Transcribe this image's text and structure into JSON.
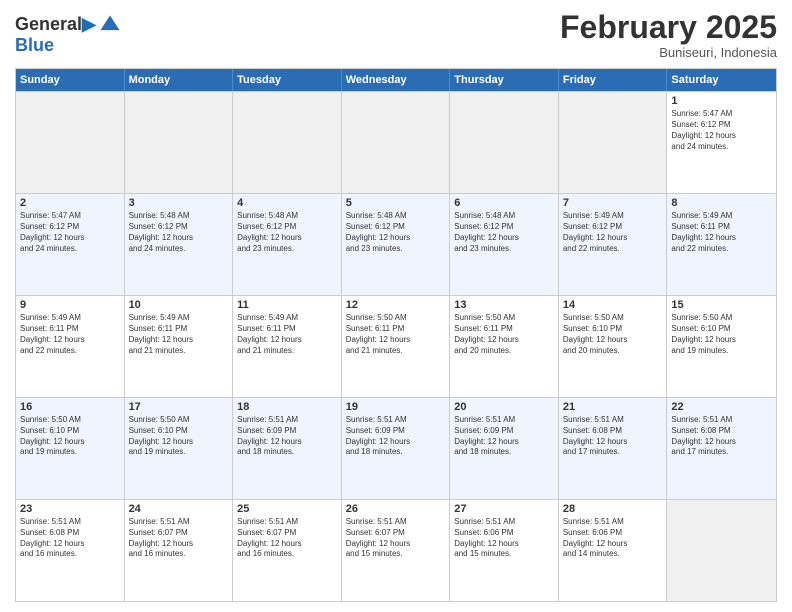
{
  "header": {
    "logo_line1": "General",
    "logo_line2": "Blue",
    "month": "February 2025",
    "location": "Buniseuri, Indonesia"
  },
  "days_of_week": [
    "Sunday",
    "Monday",
    "Tuesday",
    "Wednesday",
    "Thursday",
    "Friday",
    "Saturday"
  ],
  "weeks": [
    [
      {
        "day": "",
        "text": ""
      },
      {
        "day": "",
        "text": ""
      },
      {
        "day": "",
        "text": ""
      },
      {
        "day": "",
        "text": ""
      },
      {
        "day": "",
        "text": ""
      },
      {
        "day": "",
        "text": ""
      },
      {
        "day": "1",
        "text": "Sunrise: 5:47 AM\nSunset: 6:12 PM\nDaylight: 12 hours\nand 24 minutes."
      }
    ],
    [
      {
        "day": "2",
        "text": "Sunrise: 5:47 AM\nSunset: 6:12 PM\nDaylight: 12 hours\nand 24 minutes."
      },
      {
        "day": "3",
        "text": "Sunrise: 5:48 AM\nSunset: 6:12 PM\nDaylight: 12 hours\nand 24 minutes."
      },
      {
        "day": "4",
        "text": "Sunrise: 5:48 AM\nSunset: 6:12 PM\nDaylight: 12 hours\nand 23 minutes."
      },
      {
        "day": "5",
        "text": "Sunrise: 5:48 AM\nSunset: 6:12 PM\nDaylight: 12 hours\nand 23 minutes."
      },
      {
        "day": "6",
        "text": "Sunrise: 5:48 AM\nSunset: 6:12 PM\nDaylight: 12 hours\nand 23 minutes."
      },
      {
        "day": "7",
        "text": "Sunrise: 5:49 AM\nSunset: 6:12 PM\nDaylight: 12 hours\nand 22 minutes."
      },
      {
        "day": "8",
        "text": "Sunrise: 5:49 AM\nSunset: 6:11 PM\nDaylight: 12 hours\nand 22 minutes."
      }
    ],
    [
      {
        "day": "9",
        "text": "Sunrise: 5:49 AM\nSunset: 6:11 PM\nDaylight: 12 hours\nand 22 minutes."
      },
      {
        "day": "10",
        "text": "Sunrise: 5:49 AM\nSunset: 6:11 PM\nDaylight: 12 hours\nand 21 minutes."
      },
      {
        "day": "11",
        "text": "Sunrise: 5:49 AM\nSunset: 6:11 PM\nDaylight: 12 hours\nand 21 minutes."
      },
      {
        "day": "12",
        "text": "Sunrise: 5:50 AM\nSunset: 6:11 PM\nDaylight: 12 hours\nand 21 minutes."
      },
      {
        "day": "13",
        "text": "Sunrise: 5:50 AM\nSunset: 6:11 PM\nDaylight: 12 hours\nand 20 minutes."
      },
      {
        "day": "14",
        "text": "Sunrise: 5:50 AM\nSunset: 6:10 PM\nDaylight: 12 hours\nand 20 minutes."
      },
      {
        "day": "15",
        "text": "Sunrise: 5:50 AM\nSunset: 6:10 PM\nDaylight: 12 hours\nand 19 minutes."
      }
    ],
    [
      {
        "day": "16",
        "text": "Sunrise: 5:50 AM\nSunset: 6:10 PM\nDaylight: 12 hours\nand 19 minutes."
      },
      {
        "day": "17",
        "text": "Sunrise: 5:50 AM\nSunset: 6:10 PM\nDaylight: 12 hours\nand 19 minutes."
      },
      {
        "day": "18",
        "text": "Sunrise: 5:51 AM\nSunset: 6:09 PM\nDaylight: 12 hours\nand 18 minutes."
      },
      {
        "day": "19",
        "text": "Sunrise: 5:51 AM\nSunset: 6:09 PM\nDaylight: 12 hours\nand 18 minutes."
      },
      {
        "day": "20",
        "text": "Sunrise: 5:51 AM\nSunset: 6:09 PM\nDaylight: 12 hours\nand 18 minutes."
      },
      {
        "day": "21",
        "text": "Sunrise: 5:51 AM\nSunset: 6:08 PM\nDaylight: 12 hours\nand 17 minutes."
      },
      {
        "day": "22",
        "text": "Sunrise: 5:51 AM\nSunset: 6:08 PM\nDaylight: 12 hours\nand 17 minutes."
      }
    ],
    [
      {
        "day": "23",
        "text": "Sunrise: 5:51 AM\nSunset: 6:08 PM\nDaylight: 12 hours\nand 16 minutes."
      },
      {
        "day": "24",
        "text": "Sunrise: 5:51 AM\nSunset: 6:07 PM\nDaylight: 12 hours\nand 16 minutes."
      },
      {
        "day": "25",
        "text": "Sunrise: 5:51 AM\nSunset: 6:07 PM\nDaylight: 12 hours\nand 16 minutes."
      },
      {
        "day": "26",
        "text": "Sunrise: 5:51 AM\nSunset: 6:07 PM\nDaylight: 12 hours\nand 15 minutes."
      },
      {
        "day": "27",
        "text": "Sunrise: 5:51 AM\nSunset: 6:06 PM\nDaylight: 12 hours\nand 15 minutes."
      },
      {
        "day": "28",
        "text": "Sunrise: 5:51 AM\nSunset: 6:06 PM\nDaylight: 12 hours\nand 14 minutes."
      },
      {
        "day": "",
        "text": ""
      }
    ]
  ]
}
